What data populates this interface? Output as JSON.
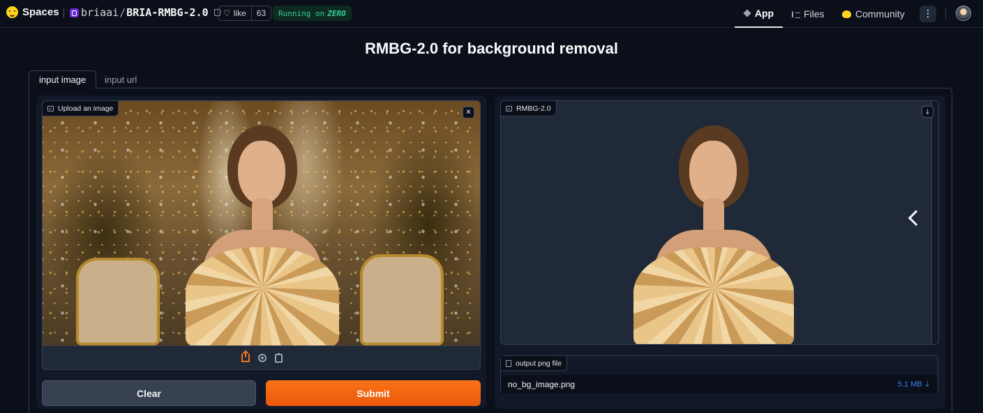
{
  "header": {
    "brand": "Spaces",
    "repo_owner": "briaai",
    "repo_name": "BRIA-RMBG-2.0",
    "like_label": "like",
    "like_count": "63",
    "status_prefix": "Running on",
    "status_hw": "ZERO",
    "nav": [
      {
        "label": "App",
        "icon": "cube-icon",
        "active": true
      },
      {
        "label": "Files",
        "icon": "files-icon",
        "active": false
      },
      {
        "label": "Community",
        "icon": "community-icon",
        "active": false
      }
    ],
    "more_label": "⋮"
  },
  "main": {
    "title": "RMBG-2.0 for background removal",
    "tabs": [
      {
        "label": "input image",
        "active": true
      },
      {
        "label": "input url",
        "active": false
      }
    ],
    "input": {
      "label": "Upload an image",
      "close_symbol": "✕",
      "sources": [
        "upload-icon",
        "webcam-icon",
        "clipboard-icon"
      ]
    },
    "output": {
      "label": "RMBG-2.0",
      "download_symbol": "⤓"
    },
    "file_output": {
      "label": "output png file",
      "file_name": "no_bg_image.png",
      "file_size": "5.1 MB ⇣"
    },
    "buttons": {
      "clear": "Clear",
      "submit": "Submit"
    }
  },
  "colors": {
    "background": "#0b0f19",
    "panel": "#111827",
    "accent": "#f97316",
    "status": "#34d399",
    "link": "#3b82f6"
  }
}
